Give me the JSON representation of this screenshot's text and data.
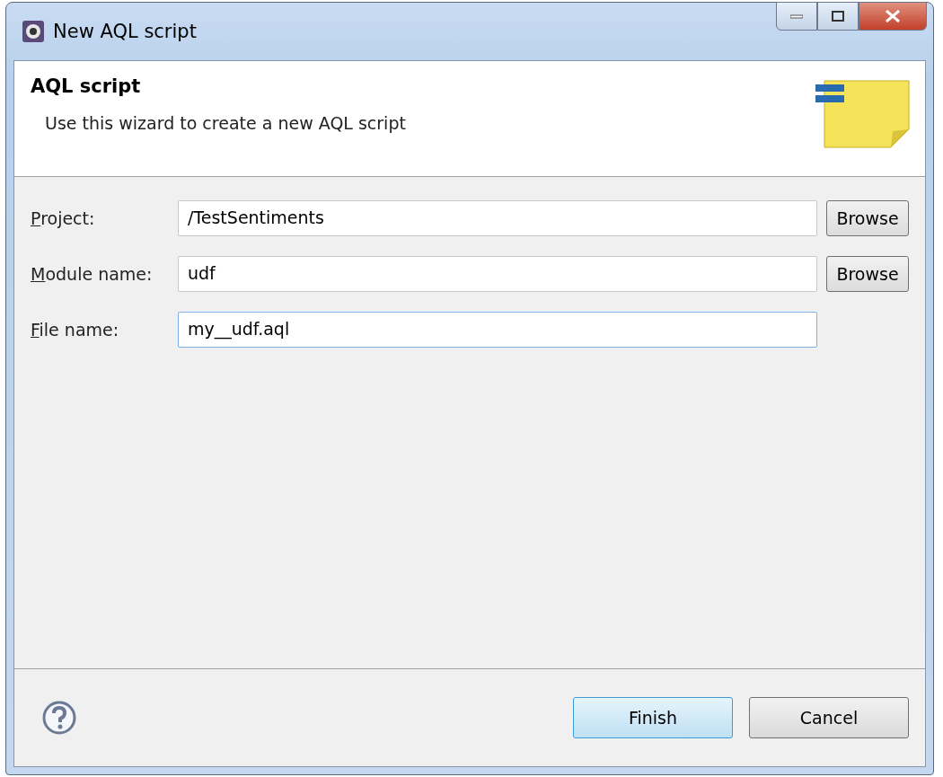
{
  "window": {
    "title": "New AQL script"
  },
  "header": {
    "title": "AQL script",
    "description": "Use this wizard to create a new AQL script"
  },
  "fields": [
    {
      "label": "Project:",
      "mnemonic": true,
      "value": "/TestSentiments",
      "focused": false,
      "browse": "Browse"
    },
    {
      "label": "Module name:",
      "mnemonic": true,
      "value": "udf",
      "focused": false,
      "browse": "Browse"
    },
    {
      "label": "File name:",
      "mnemonic": true,
      "value": "my__udf.aql",
      "focused": true
    }
  ],
  "buttons": [
    {
      "label": "Finish",
      "default": true
    },
    {
      "label": "Cancel",
      "default": false
    }
  ]
}
